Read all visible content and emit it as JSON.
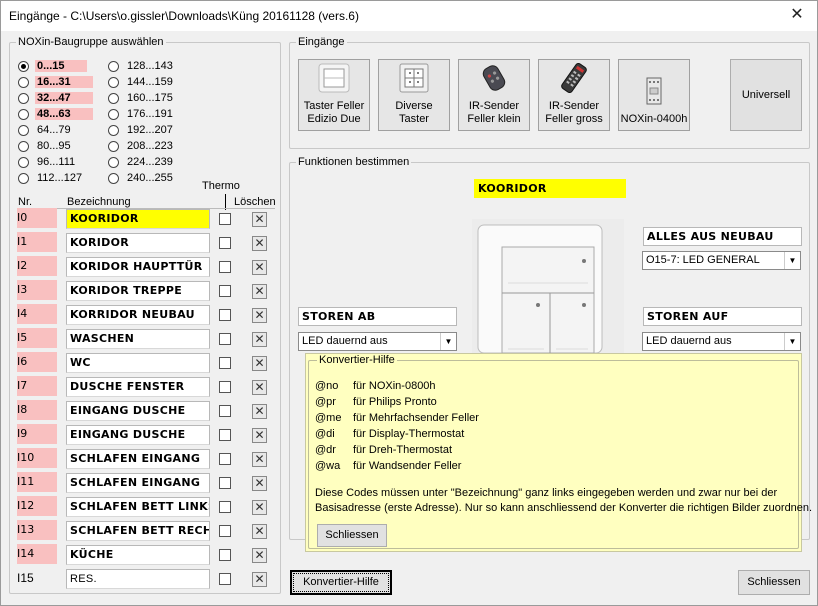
{
  "window": {
    "title": "Eingänge - C:\\Users\\o.gissler\\Downloads\\Küng 20161128 (vers.6)",
    "close": "✕"
  },
  "baugruppe": {
    "title": "NOXin-Baugruppe auswählen",
    "ranges": [
      {
        "label": "0...15",
        "selected": true,
        "highlight": true
      },
      {
        "label": "16...31",
        "selected": false,
        "highlight": true
      },
      {
        "label": "32...47",
        "selected": false,
        "highlight": true
      },
      {
        "label": "48...63",
        "selected": false,
        "highlight": true
      },
      {
        "label": "64...79",
        "selected": false,
        "highlight": false
      },
      {
        "label": "80...95",
        "selected": false,
        "highlight": false
      },
      {
        "label": "96...111",
        "selected": false,
        "highlight": false
      },
      {
        "label": "112...127",
        "selected": false,
        "highlight": false
      },
      {
        "label": "128...143",
        "selected": false,
        "highlight": false
      },
      {
        "label": "144...159",
        "selected": false,
        "highlight": false
      },
      {
        "label": "160...175",
        "selected": false,
        "highlight": false
      },
      {
        "label": "176...191",
        "selected": false,
        "highlight": false
      },
      {
        "label": "192...207",
        "selected": false,
        "highlight": false
      },
      {
        "label": "208...223",
        "selected": false,
        "highlight": false
      },
      {
        "label": "224...239",
        "selected": false,
        "highlight": false
      },
      {
        "label": "240...255",
        "selected": false,
        "highlight": false
      }
    ]
  },
  "table": {
    "col_nr": "Nr.",
    "col_name": "Bezeichnung",
    "col_thermo": "Thermo",
    "col_delete": "Löschen",
    "delete_glyph": "✕",
    "rows": [
      {
        "nr": "I0",
        "name": "KOORIDOR",
        "pink": true,
        "yellow": true,
        "bold": true
      },
      {
        "nr": "I1",
        "name": "KORIDOR",
        "pink": true,
        "yellow": false,
        "bold": true
      },
      {
        "nr": "I2",
        "name": "KORIDOR HAUPTTÜR",
        "pink": true,
        "yellow": false,
        "bold": true
      },
      {
        "nr": "I3",
        "name": "KORIDOR TREPPE",
        "pink": true,
        "yellow": false,
        "bold": true
      },
      {
        "nr": "I4",
        "name": "KORRIDOR NEUBAU",
        "pink": true,
        "yellow": false,
        "bold": true
      },
      {
        "nr": "I5",
        "name": "WASCHEN",
        "pink": true,
        "yellow": false,
        "bold": true
      },
      {
        "nr": "I6",
        "name": "WC",
        "pink": true,
        "yellow": false,
        "bold": true
      },
      {
        "nr": "I7",
        "name": "DUSCHE FENSTER",
        "pink": true,
        "yellow": false,
        "bold": true
      },
      {
        "nr": "I8",
        "name": "EINGANG DUSCHE",
        "pink": true,
        "yellow": false,
        "bold": true
      },
      {
        "nr": "I9",
        "name": "EINGANG DUSCHE",
        "pink": true,
        "yellow": false,
        "bold": true
      },
      {
        "nr": "I10",
        "name": "SCHLAFEN EINGANG",
        "pink": true,
        "yellow": false,
        "bold": true
      },
      {
        "nr": "I11",
        "name": "SCHLAFEN EINGANG",
        "pink": true,
        "yellow": false,
        "bold": true
      },
      {
        "nr": "I12",
        "name": "SCHLAFEN BETT LINKS",
        "pink": true,
        "yellow": false,
        "bold": true
      },
      {
        "nr": "I13",
        "name": "SCHLAFEN BETT RECH",
        "pink": true,
        "yellow": false,
        "bold": true
      },
      {
        "nr": "I14",
        "name": "KÜCHE",
        "pink": true,
        "yellow": false,
        "bold": true
      },
      {
        "nr": "I15",
        "name": "RES.",
        "pink": false,
        "yellow": false,
        "bold": false
      }
    ]
  },
  "eingaenge": {
    "title": "Eingänge",
    "buttons": [
      {
        "line1": "Taster Feller",
        "line2": "Edizio Due",
        "icon": "switch-white-icon"
      },
      {
        "line1": "Diverse",
        "line2": "Taster",
        "icon": "switch-quad-icon"
      },
      {
        "line1": "IR-Sender",
        "line2": "Feller klein",
        "icon": "remote-small-icon"
      },
      {
        "line1": "IR-Sender",
        "line2": "Feller gross",
        "icon": "remote-large-icon"
      },
      {
        "line1": "",
        "line2": "NOXin-0400h",
        "icon": "module-icon"
      }
    ],
    "universal_label": "Universell"
  },
  "funktionen": {
    "title": "Funktionen bestimmen",
    "top_field": "KOORIDOR",
    "right_top_field": "ALLES AUS NEUBAU",
    "right_top_combo": "O15-7: LED GENERAL",
    "left_field": "STOREN AB",
    "left_combo": "LED dauernd aus",
    "right_field": "STOREN AUF",
    "right_combo": "LED dauernd aus"
  },
  "help": {
    "title": "Konvertier-Hilfe",
    "codes": [
      {
        "code": "@no",
        "text": "für NOXin-0800h"
      },
      {
        "code": "@pr",
        "text": "für Philips Pronto"
      },
      {
        "code": "@me",
        "text": "für Mehrfachsender Feller"
      },
      {
        "code": "@di",
        "text": "für Display-Thermostat"
      },
      {
        "code": "@dr",
        "text": "für Dreh-Thermostat"
      },
      {
        "code": "@wa",
        "text": "für Wandsender Feller"
      }
    ],
    "note_line1": "Diese Codes müssen unter \"Bezeichnung\" ganz links eingegeben werden und zwar nur bei der",
    "note_line2": "Basisadresse (erste Adresse). Nur so kann anschliessend der Konverter die richtigen Bilder zuordnen.",
    "close_label": "Schliessen"
  },
  "footer": {
    "convert_help_label": "Konvertier-Hilfe",
    "close_label": "Schliessen"
  },
  "colors": {
    "pink": "#f9c0c0",
    "yellow": "#ffff00",
    "help_bg": "#ffffc0"
  }
}
